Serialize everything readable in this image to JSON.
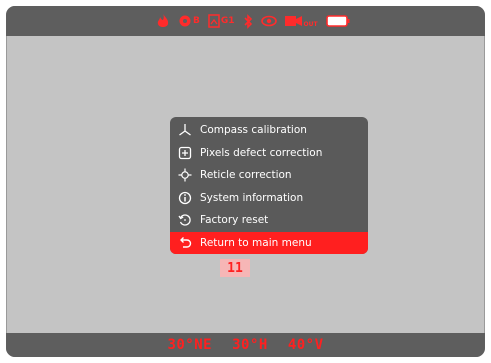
{
  "status_bar": {
    "icons": [
      {
        "name": "flame-icon"
      },
      {
        "name": "gear-icon",
        "text": "B"
      },
      {
        "name": "picture-mode-icon",
        "text": "G1"
      },
      {
        "name": "bluetooth-icon"
      },
      {
        "name": "eye-icon"
      },
      {
        "name": "video-out-icon",
        "text": "OUT"
      },
      {
        "name": "battery-icon"
      }
    ]
  },
  "menu": {
    "items": [
      {
        "label": "Compass calibration",
        "icon": "compass-icon"
      },
      {
        "label": "Pixels defect correction",
        "icon": "plus-square-icon"
      },
      {
        "label": "Reticle correction",
        "icon": "crosshair-icon"
      },
      {
        "label": "System information",
        "icon": "info-icon"
      },
      {
        "label": "Factory reset",
        "icon": "reset-icon"
      },
      {
        "label": "Return to main menu",
        "icon": "return-icon",
        "selected": true
      }
    ],
    "page_indicator": "11"
  },
  "readout": {
    "heading": "30°NE",
    "tilt": "30°H",
    "temperature": "40°V"
  },
  "colors": {
    "accent": "#ff1f1f",
    "bar": "#5e5e5e",
    "background": "#c4c4c4",
    "menu": "#5a5a5a"
  }
}
